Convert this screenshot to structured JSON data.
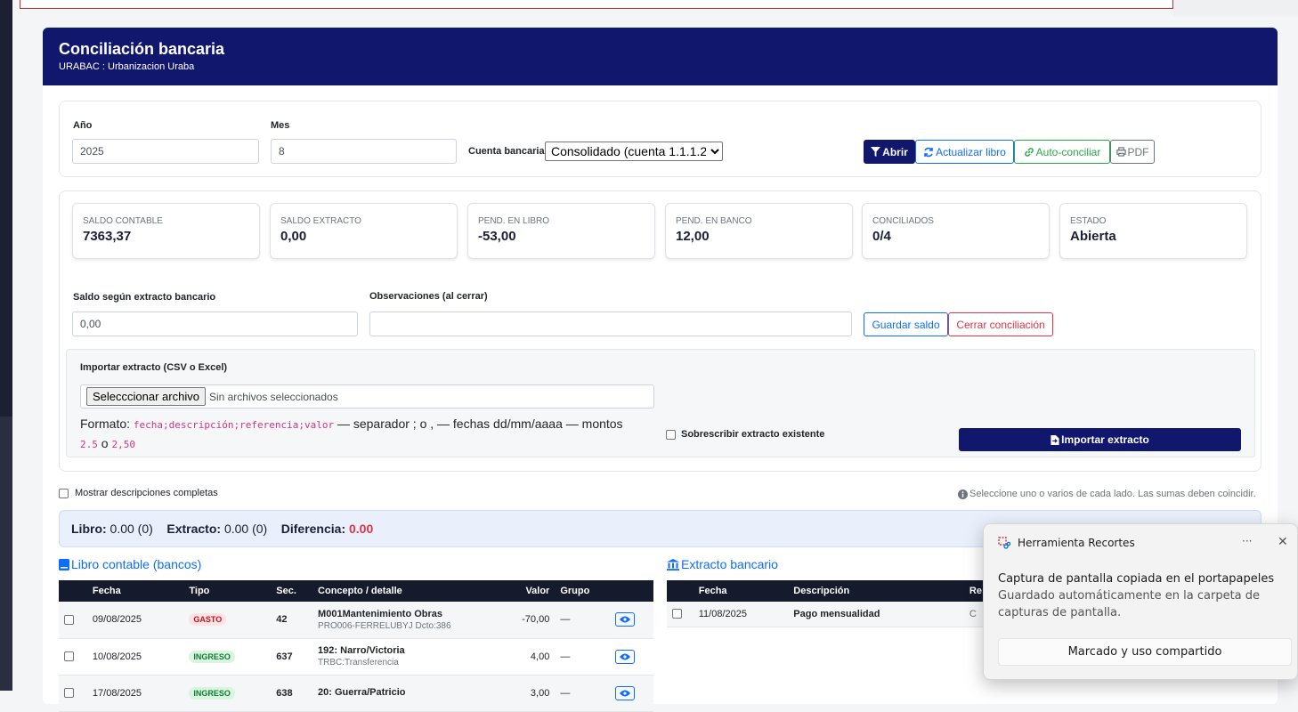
{
  "header": {
    "title": "Conciliación bancaria",
    "subtitle": "URABAC : Urbanizacion Uraba"
  },
  "filters": {
    "year_label": "Año",
    "year_value": "2025",
    "month_label": "Mes",
    "month_value": "8",
    "account_label": "Cuenta bancaria",
    "account_value": "Consolidado (cuenta 1.1.1.2)",
    "open_label": "Abrir",
    "refresh_label": "Actualizar libro",
    "autoconcile_label": "Auto-conciliar",
    "pdf_label": "PDF"
  },
  "stats": [
    {
      "title": "SALDO CONTABLE",
      "value": "7363,37"
    },
    {
      "title": "SALDO EXTRACTO",
      "value": "0,00"
    },
    {
      "title": "PEND. EN LIBRO",
      "value": "-53,00"
    },
    {
      "title": "PEND. EN BANCO",
      "value": "12,00"
    },
    {
      "title": "CONCILIADOS",
      "value": "0/4"
    },
    {
      "title": "ESTADO",
      "value": "Abierta"
    }
  ],
  "balance": {
    "label": "Saldo según extracto bancario",
    "value": "0,00",
    "obs_label": "Observaciones (al cerrar)",
    "obs_value": "",
    "save_label": "Guardar saldo",
    "close_label": "Cerrar conciliación"
  },
  "import": {
    "title": "Importar extracto (CSV o Excel)",
    "file_button": "Selecccionar archivo",
    "file_status": "Sin archivos seleccionados",
    "format_prefix": "Formato:",
    "format_code": "fecha;descripción;referencia;valor",
    "format_mid": "— separador ; o , — fechas dd/mm/aaaa — montos",
    "amount_a": "2.5",
    "or_word": "o",
    "amount_b": "2,50",
    "overwrite_label": "Sobrescribir extracto existente",
    "import_button": "Importar extracto"
  },
  "options": {
    "full_desc_label": "Mostrar descripciones completas",
    "hint": "Seleccione uno o varios de cada lado. Las sumas deben coincidir."
  },
  "summary": {
    "book_label": "Libro:",
    "book_value": "0.00 (0)",
    "statement_label": "Extracto:",
    "statement_value": "0.00 (0)",
    "diff_label": "Diferencia:",
    "diff_value": "0.00"
  },
  "book": {
    "title": "Libro contable (bancos)",
    "columns": [
      "Fecha",
      "Tipo",
      "Sec.",
      "Concepto / detalle",
      "Valor",
      "Grupo"
    ],
    "rows": [
      {
        "date": "09/08/2025",
        "type": "GASTO",
        "sec": "42",
        "concept": "M001Mantenimiento Obras",
        "detail": "PRO006-FERRELUBYJ Dcto:386",
        "value": "-70,00",
        "group": "—"
      },
      {
        "date": "10/08/2025",
        "type": "INGRESO",
        "sec": "637",
        "concept": "192: Narro/Victoria",
        "detail": "TRBC:Transferencia",
        "value": "4,00",
        "group": "—"
      },
      {
        "date": "17/08/2025",
        "type": "INGRESO",
        "sec": "638",
        "concept": "20: Guerra/Patricio",
        "detail": "",
        "value": "3,00",
        "group": "—"
      }
    ]
  },
  "statement": {
    "title": "Extracto bancario",
    "columns": [
      "Fecha",
      "Descripción",
      "Re"
    ],
    "rows": [
      {
        "date": "11/08/2025",
        "desc": "Pago mensualidad",
        "ref": "C"
      }
    ]
  },
  "toast": {
    "app": "Herramienta Recortes",
    "more": "···",
    "title": "Captura de pantalla copiada en el portapapeles",
    "message": "Guardado automáticamente en la carpeta de capturas de pantalla.",
    "action": "Marcado y uso compartido"
  }
}
